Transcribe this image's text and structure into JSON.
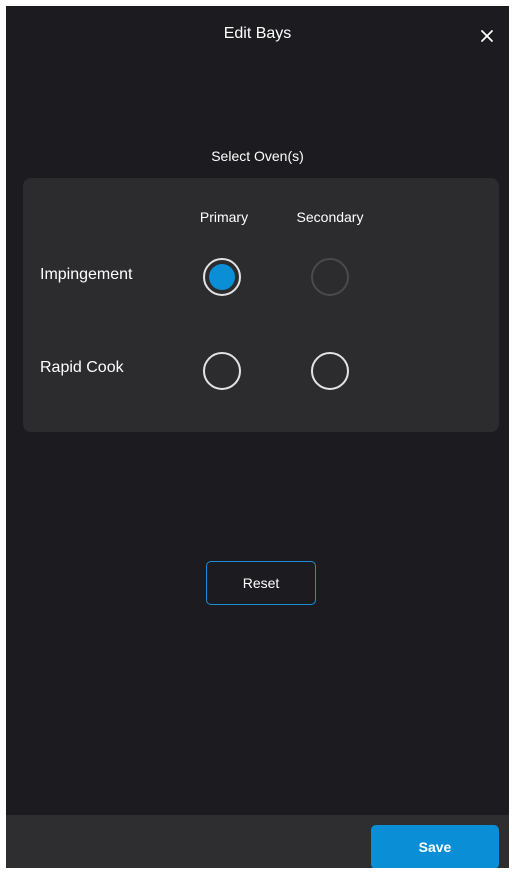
{
  "header": {
    "title": "Edit Bays",
    "close_icon": "close-icon"
  },
  "oven_selection": {
    "title": "Select Oven(s)",
    "columns": [
      "Primary",
      "Secondary"
    ],
    "rows": [
      {
        "label": "Impingement",
        "primary": {
          "selected": true,
          "enabled": true
        },
        "secondary": {
          "selected": false,
          "enabled": false
        }
      },
      {
        "label": "Rapid Cook",
        "primary": {
          "selected": false,
          "enabled": true
        },
        "secondary": {
          "selected": false,
          "enabled": true
        }
      }
    ]
  },
  "actions": {
    "reset_label": "Reset",
    "save_label": "Save"
  },
  "colors": {
    "background": "#1c1c20",
    "card": "#2c2c2f",
    "accent": "#0a8fd6",
    "footer": "#2e2e31"
  }
}
